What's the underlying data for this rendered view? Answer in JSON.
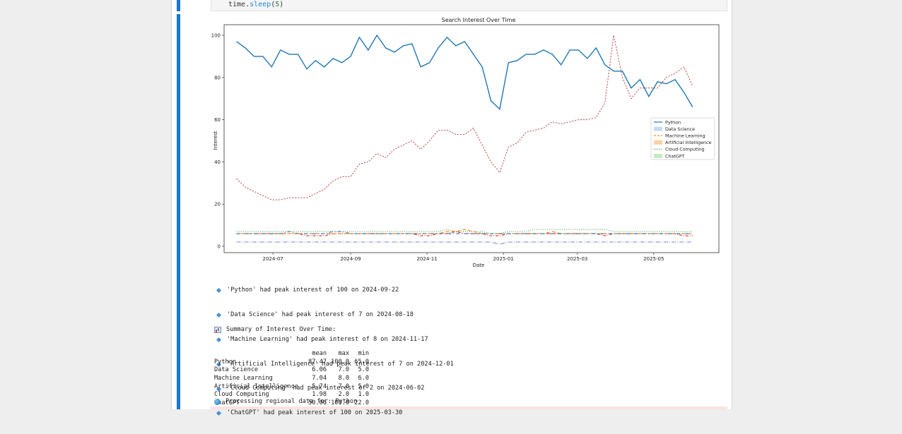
{
  "code": {
    "prefix": "time.",
    "fn": "sleep",
    "open": "(",
    "arg": "5",
    "close": ")"
  },
  "chart_data": {
    "type": "line",
    "title": "Search Interest Over Time",
    "xlabel": "Date",
    "ylabel": "Interest",
    "ylim": [
      -3,
      105
    ],
    "xlim": [
      "2024-05-23",
      "2025-06-22"
    ],
    "grid": false,
    "legend_position": "center-right",
    "yticks": [
      0,
      20,
      40,
      60,
      80,
      100
    ],
    "xticks": [
      {
        "date": "2024-07-01",
        "label": "2024-07"
      },
      {
        "date": "2024-09-01",
        "label": "2024-09"
      },
      {
        "date": "2024-11-01",
        "label": "2024-11"
      },
      {
        "date": "2025-01-01",
        "label": "2025-01"
      },
      {
        "date": "2025-03-01",
        "label": "2025-03"
      },
      {
        "date": "2025-05-01",
        "label": "2025-05"
      }
    ],
    "x_start": "2024-06-02",
    "x_step_days": 7,
    "series": [
      {
        "name": "Python",
        "color": "#1f77b4",
        "dash": "",
        "values": [
          97,
          94,
          90,
          90,
          85,
          93,
          91,
          91,
          84,
          88,
          85,
          89,
          87,
          90,
          99,
          93,
          100,
          94,
          92,
          95,
          96,
          85,
          87,
          94,
          99,
          95,
          97,
          91,
          85,
          69,
          65,
          87,
          88,
          91,
          91,
          93,
          91,
          86,
          93,
          93,
          89,
          94,
          86,
          83,
          83,
          75,
          79,
          71,
          78,
          77,
          79,
          73,
          66
        ]
      },
      {
        "name": "Data Science",
        "color": "#1f77b4",
        "dash": "5,3,1,3",
        "values": [
          6,
          6,
          6,
          6,
          6,
          6,
          7,
          6,
          6,
          6,
          6,
          7,
          7,
          6,
          6,
          6,
          6,
          6,
          6,
          6,
          6,
          6,
          6,
          6,
          6,
          6,
          6,
          6,
          6,
          6,
          6,
          6,
          6,
          6,
          6,
          6,
          6,
          6,
          6,
          6,
          6,
          6,
          6,
          6,
          6,
          6,
          6,
          6,
          6,
          6,
          6,
          6,
          6
        ]
      },
      {
        "name": "Machine Learning",
        "color": "#ff7f0e",
        "dash": "5,3",
        "values": [
          6,
          6,
          6,
          6,
          6,
          6,
          6,
          6,
          6,
          6,
          6,
          6,
          6,
          6,
          6,
          6,
          6,
          6,
          6,
          6,
          6,
          6,
          6,
          6,
          7,
          7,
          8,
          7,
          6,
          6,
          6,
          6,
          6,
          6,
          6,
          6,
          7,
          6,
          6,
          6,
          6,
          6,
          6,
          6,
          6,
          6,
          6,
          6,
          6,
          6,
          6,
          6,
          6
        ]
      },
      {
        "name": "Artificial Intelligence",
        "color": "#d62728",
        "dash": "4,2,1,2",
        "values": [
          6,
          6,
          6,
          6,
          6,
          6,
          6,
          6,
          5,
          5,
          5,
          6,
          6,
          6,
          6,
          6,
          6,
          6,
          6,
          6,
          6,
          5,
          5,
          6,
          6,
          7,
          6,
          6,
          6,
          5,
          5,
          6,
          6,
          6,
          6,
          6,
          6,
          6,
          6,
          6,
          6,
          6,
          5,
          6,
          6,
          6,
          6,
          6,
          6,
          6,
          6,
          5,
          5
        ]
      },
      {
        "name": "Cloud Computing",
        "color": "#7f7fdf",
        "dash": "6,2,1,2",
        "values": [
          2,
          2,
          2,
          2,
          2,
          2,
          2,
          2,
          2,
          2,
          2,
          2,
          2,
          2,
          2,
          2,
          2,
          2,
          2,
          2,
          2,
          2,
          2,
          2,
          2,
          2,
          2,
          2,
          2,
          2,
          1,
          2,
          2,
          2,
          2,
          2,
          2,
          2,
          2,
          2,
          2,
          2,
          2,
          2,
          2,
          2,
          2,
          2,
          2,
          2,
          2,
          2,
          2
        ]
      },
      {
        "name": "ChatGPT",
        "color": "#c0504d",
        "dash": "2,2",
        "values": [
          32,
          28,
          26,
          24,
          22,
          22,
          23,
          23,
          23,
          25,
          27,
          31,
          33,
          33,
          39,
          40,
          44,
          42,
          46,
          48,
          50,
          46,
          50,
          55,
          55,
          53,
          53,
          56,
          48,
          40,
          35,
          47,
          49,
          54,
          55,
          56,
          59,
          58,
          59,
          60,
          60,
          61,
          68,
          100,
          80,
          70,
          75,
          75,
          75,
          80,
          82,
          85,
          76
        ]
      }
    ],
    "extra_lines": [
      {
        "name": "Cloud Computing overlay",
        "color": "#2ca02c",
        "dash": "1,2",
        "values": [
          7,
          7,
          7,
          7,
          7,
          7,
          7,
          7,
          7,
          7,
          7,
          7,
          7,
          7,
          7,
          7,
          7,
          7,
          7,
          7,
          7,
          7,
          7,
          7,
          8,
          7,
          7,
          7,
          7,
          6,
          6,
          7,
          7,
          7,
          8,
          8,
          8,
          8,
          8,
          8,
          8,
          8,
          8,
          7,
          7,
          7,
          7,
          7,
          7,
          7,
          7,
          7,
          7
        ]
      }
    ],
    "legend": [
      {
        "label": "Python",
        "kind": "line",
        "color": "#1f77b4"
      },
      {
        "label": "Data Science",
        "kind": "patch",
        "color": "#c6dbef"
      },
      {
        "label": "Machine Learning",
        "kind": "dashline",
        "color": "#ff7f0e"
      },
      {
        "label": "Artificial Intelligence",
        "kind": "patch",
        "color": "#fdd0a2"
      },
      {
        "label": "Cloud Computing",
        "kind": "dotline",
        "color": "#2ca02c"
      },
      {
        "label": "ChatGPT",
        "kind": "patch",
        "color": "#c7e9c0"
      }
    ]
  },
  "peaks": [
    "'Python' had peak interest of 100 on 2024-09-22",
    "'Data Science' had peak interest of 7 on 2024-08-18",
    "'Machine Learning' had peak interest of 8 on 2024-11-17",
    "'Artificial Intelligence' had peak interest of 7 on 2024-12-01",
    "'Cloud Computing' had peak interest of 2 on 2024-06-02",
    "'ChatGPT' had peak interest of 100 on 2025-03-30"
  ],
  "summary": {
    "title": "Summary of Interest Over Time:",
    "columns": [
      "mean",
      "max",
      "min"
    ],
    "rows": [
      {
        "name": "Python",
        "mean": "87.47",
        "max": "100.0",
        "min": "65.0"
      },
      {
        "name": "Data Science",
        "mean": "6.06",
        "max": "7.0",
        "min": "5.0"
      },
      {
        "name": "Machine Learning",
        "mean": "7.04",
        "max": "8.0",
        "min": "6.0"
      },
      {
        "name": "Artificial Intelligence",
        "mean": "5.74",
        "max": "7.0",
        "min": "5.0"
      },
      {
        "name": "Cloud Computing",
        "mean": "1.98",
        "max": "2.0",
        "min": "1.0"
      },
      {
        "name": "ChatGPT",
        "mean": "50.06",
        "max": "100.0",
        "min": "22.0"
      }
    ]
  },
  "processing": "Processing regional data for: Python"
}
